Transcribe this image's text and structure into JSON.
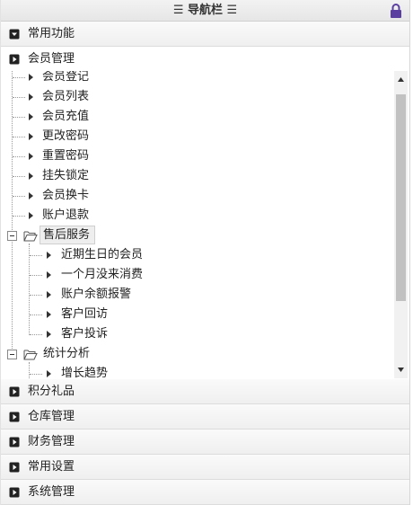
{
  "header": {
    "title": "☰ 导航栏 ☰",
    "lock_icon": "lock-icon",
    "lock_color": "#5b3fa0"
  },
  "sections_top": [
    {
      "label": "常用功能",
      "state": "collapsed"
    },
    {
      "label": "会员管理",
      "state": "expanded"
    }
  ],
  "tree": {
    "member_items": [
      "会员登记",
      "会员列表",
      "会员充值",
      "更改密码",
      "重置密码",
      "挂失锁定",
      "会员换卡",
      "账户退款"
    ],
    "after_sales": {
      "label": "售后服务",
      "children": [
        "近期生日的会员",
        "一个月没来消费",
        "账户余额报警",
        "客户回访",
        "客户投诉"
      ]
    },
    "stats": {
      "label": "统计分析",
      "children": [
        "增长趋势"
      ]
    }
  },
  "sections_bottom": [
    {
      "label": "积分礼品"
    },
    {
      "label": "仓库管理"
    },
    {
      "label": "财务管理"
    },
    {
      "label": "常用设置"
    },
    {
      "label": "系统管理"
    }
  ]
}
